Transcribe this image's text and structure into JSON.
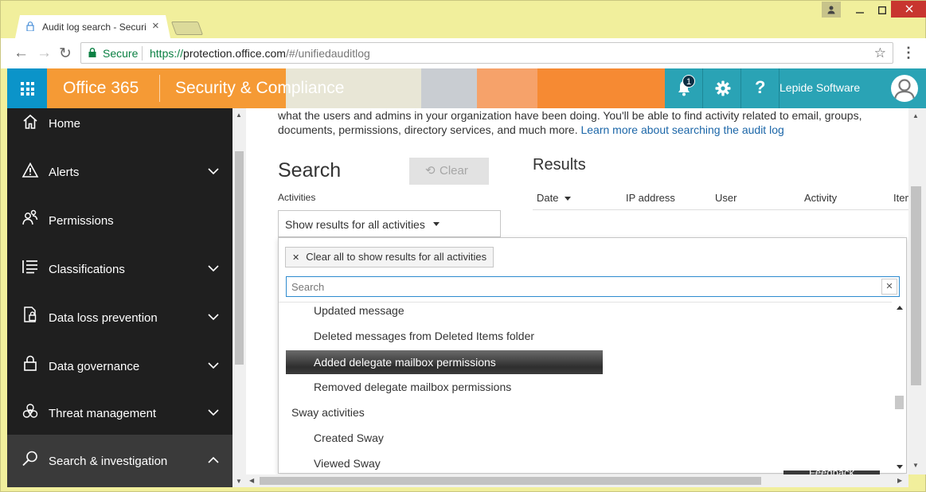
{
  "browser": {
    "tab_title": "Audit log search - Securi",
    "tab_close": "×",
    "secure_label": "Secure",
    "url_scheme": "https://",
    "url_host": "protection.office.com",
    "url_path": "/#/unifiedauditlog"
  },
  "header": {
    "app_name": "Office 365",
    "suite_name": "Security & Compliance",
    "notification_count": "1",
    "help_symbol": "?",
    "user_name": "Lepide Software",
    "colors": {
      "waffle": "#0b94c9",
      "right": "#2aa3b5"
    }
  },
  "sidebar": {
    "items": [
      {
        "label": "Home",
        "icon": "home-icon",
        "expandable": false
      },
      {
        "label": "Alerts",
        "icon": "warning-icon",
        "expandable": true
      },
      {
        "label": "Permissions",
        "icon": "people-icon",
        "expandable": false
      },
      {
        "label": "Classifications",
        "icon": "list-icon",
        "expandable": true
      },
      {
        "label": "Data loss prevention",
        "icon": "document-lock-icon",
        "expandable": true
      },
      {
        "label": "Data governance",
        "icon": "lock-icon",
        "expandable": true
      },
      {
        "label": "Threat management",
        "icon": "biohazard-icon",
        "expandable": true
      },
      {
        "label": "Search & investigation",
        "icon": "search-icon",
        "expandable": true,
        "expanded": true
      }
    ]
  },
  "main": {
    "intro_text": "what the users and admins in your organization have been doing. You'll be able to find activity related to email, groups, documents, permissions, directory services, and much more.",
    "intro_link": "Learn more about searching the audit log",
    "search_heading": "Search",
    "clear_label": "Clear",
    "activities_label": "Activities",
    "activities_value": "Show results for all activities",
    "results_heading": "Results",
    "columns": [
      "Date",
      "IP address",
      "User",
      "Activity",
      "Item"
    ]
  },
  "dropdown": {
    "chip_label": "Clear all to show results for all activities",
    "search_placeholder": "Search",
    "options": [
      {
        "label": "Updated message",
        "kind": "child"
      },
      {
        "label": "Deleted messages from Deleted Items folder",
        "kind": "child"
      },
      {
        "label": "Added delegate mailbox permissions",
        "kind": "child",
        "selected": true
      },
      {
        "label": "Removed delegate mailbox permissions",
        "kind": "child"
      },
      {
        "label": "Sway activities",
        "kind": "group"
      },
      {
        "label": "Created Sway",
        "kind": "child"
      },
      {
        "label": "Viewed Sway",
        "kind": "child"
      }
    ]
  },
  "feedback_label": "Feedback"
}
